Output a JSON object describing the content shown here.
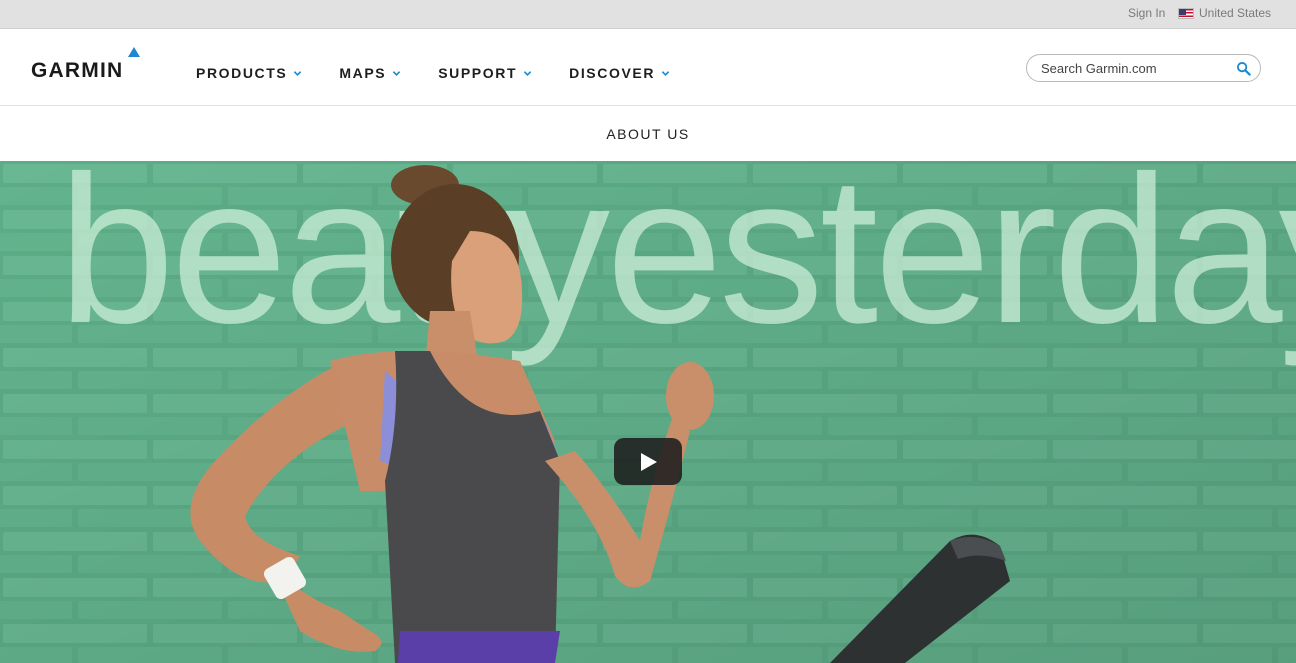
{
  "utility_bar": {
    "sign_in": "Sign In",
    "country": "United States",
    "flag_icon": "us-flag-icon"
  },
  "header": {
    "logo_text": "GARMIN",
    "nav": [
      {
        "label": "PRODUCTS"
      },
      {
        "label": "MAPS"
      },
      {
        "label": "SUPPORT"
      },
      {
        "label": "DISCOVER"
      }
    ],
    "search": {
      "placeholder": "Search Garmin.com",
      "value": ""
    }
  },
  "subnav": {
    "about": "ABOUT US"
  },
  "hero": {
    "headline": "beat yesterday",
    "has_video_play_button": true
  },
  "colors": {
    "accent_blue": "#1d88d0",
    "hero_green": "#5dac86",
    "utility_bar_bg": "#e1e1e1",
    "nav_text": "#1e1e1e"
  }
}
